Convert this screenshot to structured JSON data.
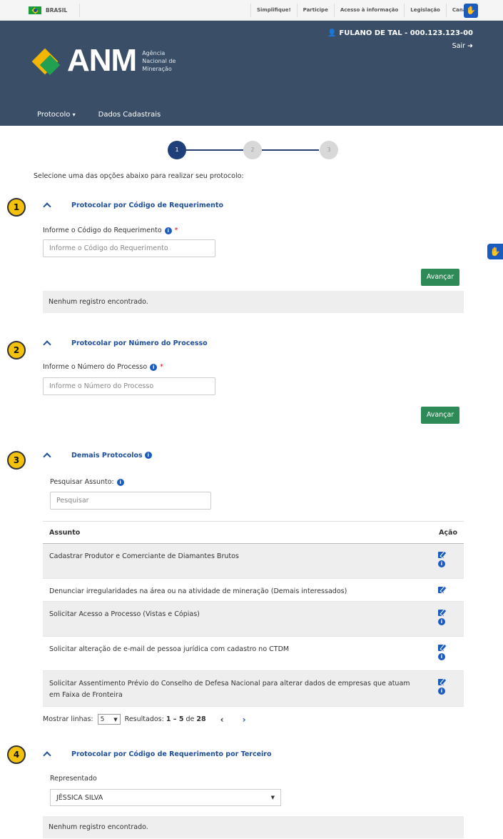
{
  "gov_bar": {
    "country": "BRASIL",
    "links": [
      "Simplifique!",
      "Participe",
      "Acesso à informação",
      "Legislação",
      "Canais"
    ]
  },
  "header": {
    "user": "FULANO DE TAL - 000.123.123-00",
    "logout": "Sair",
    "logo_text": "ANM",
    "logo_sub_1": "Agência",
    "logo_sub_2": "Nacional de",
    "logo_sub_3": "Mineração",
    "menu": [
      "Protocolo",
      "Dados Cadastrais"
    ]
  },
  "steps": [
    "1",
    "2",
    "3"
  ],
  "intro": "Selecione uma das opções abaixo para realizar seu protocolo:",
  "section1": {
    "badge": "1",
    "title": "Protocolar por Código de Requerimento",
    "label": "Informe o Código do Requerimento",
    "placeholder": "Informe o Código do Requerimento",
    "button": "Avançar",
    "empty": "Nenhum registro encontrado."
  },
  "section2": {
    "badge": "2",
    "title": "Protocolar por Número do Processo",
    "label": "Informe o Número do Processo",
    "placeholder": "Informe o Número do Processo",
    "button": "Avançar"
  },
  "section3": {
    "badge": "3",
    "title": "Demais Protocolos",
    "search_label": "Pesquisar Assunto:",
    "search_placeholder": "Pesquisar",
    "col_subject": "Assunto",
    "col_action": "Ação",
    "rows": [
      "Cadastrar Produtor e Comerciante de Diamantes Brutos",
      "Denunciar irregularidades na área ou na atividade de mineração (Demais interessados)",
      "Solicitar Acesso a Processo (Vistas e Cópias)",
      "Solicitar alteração de e-mail de pessoa jurídica com cadastro no CTDM",
      "Solicitar Assentimento Prévio do Conselho de Defesa Nacional para alterar dados de empresas que atuam em Faixa de Fronteira"
    ],
    "pager_label": "Mostrar linhas:",
    "pager_value": "5",
    "results_label": "Resultados:",
    "results_range": "1 – 5",
    "results_of": "de",
    "results_total": "28"
  },
  "section4": {
    "badge": "4",
    "title": "Protocolar por Código de Requerimento por Terceiro",
    "label": "Representado",
    "selected": "JÉSSICA SILVA",
    "empty": "Nenhum registro encontrado."
  }
}
